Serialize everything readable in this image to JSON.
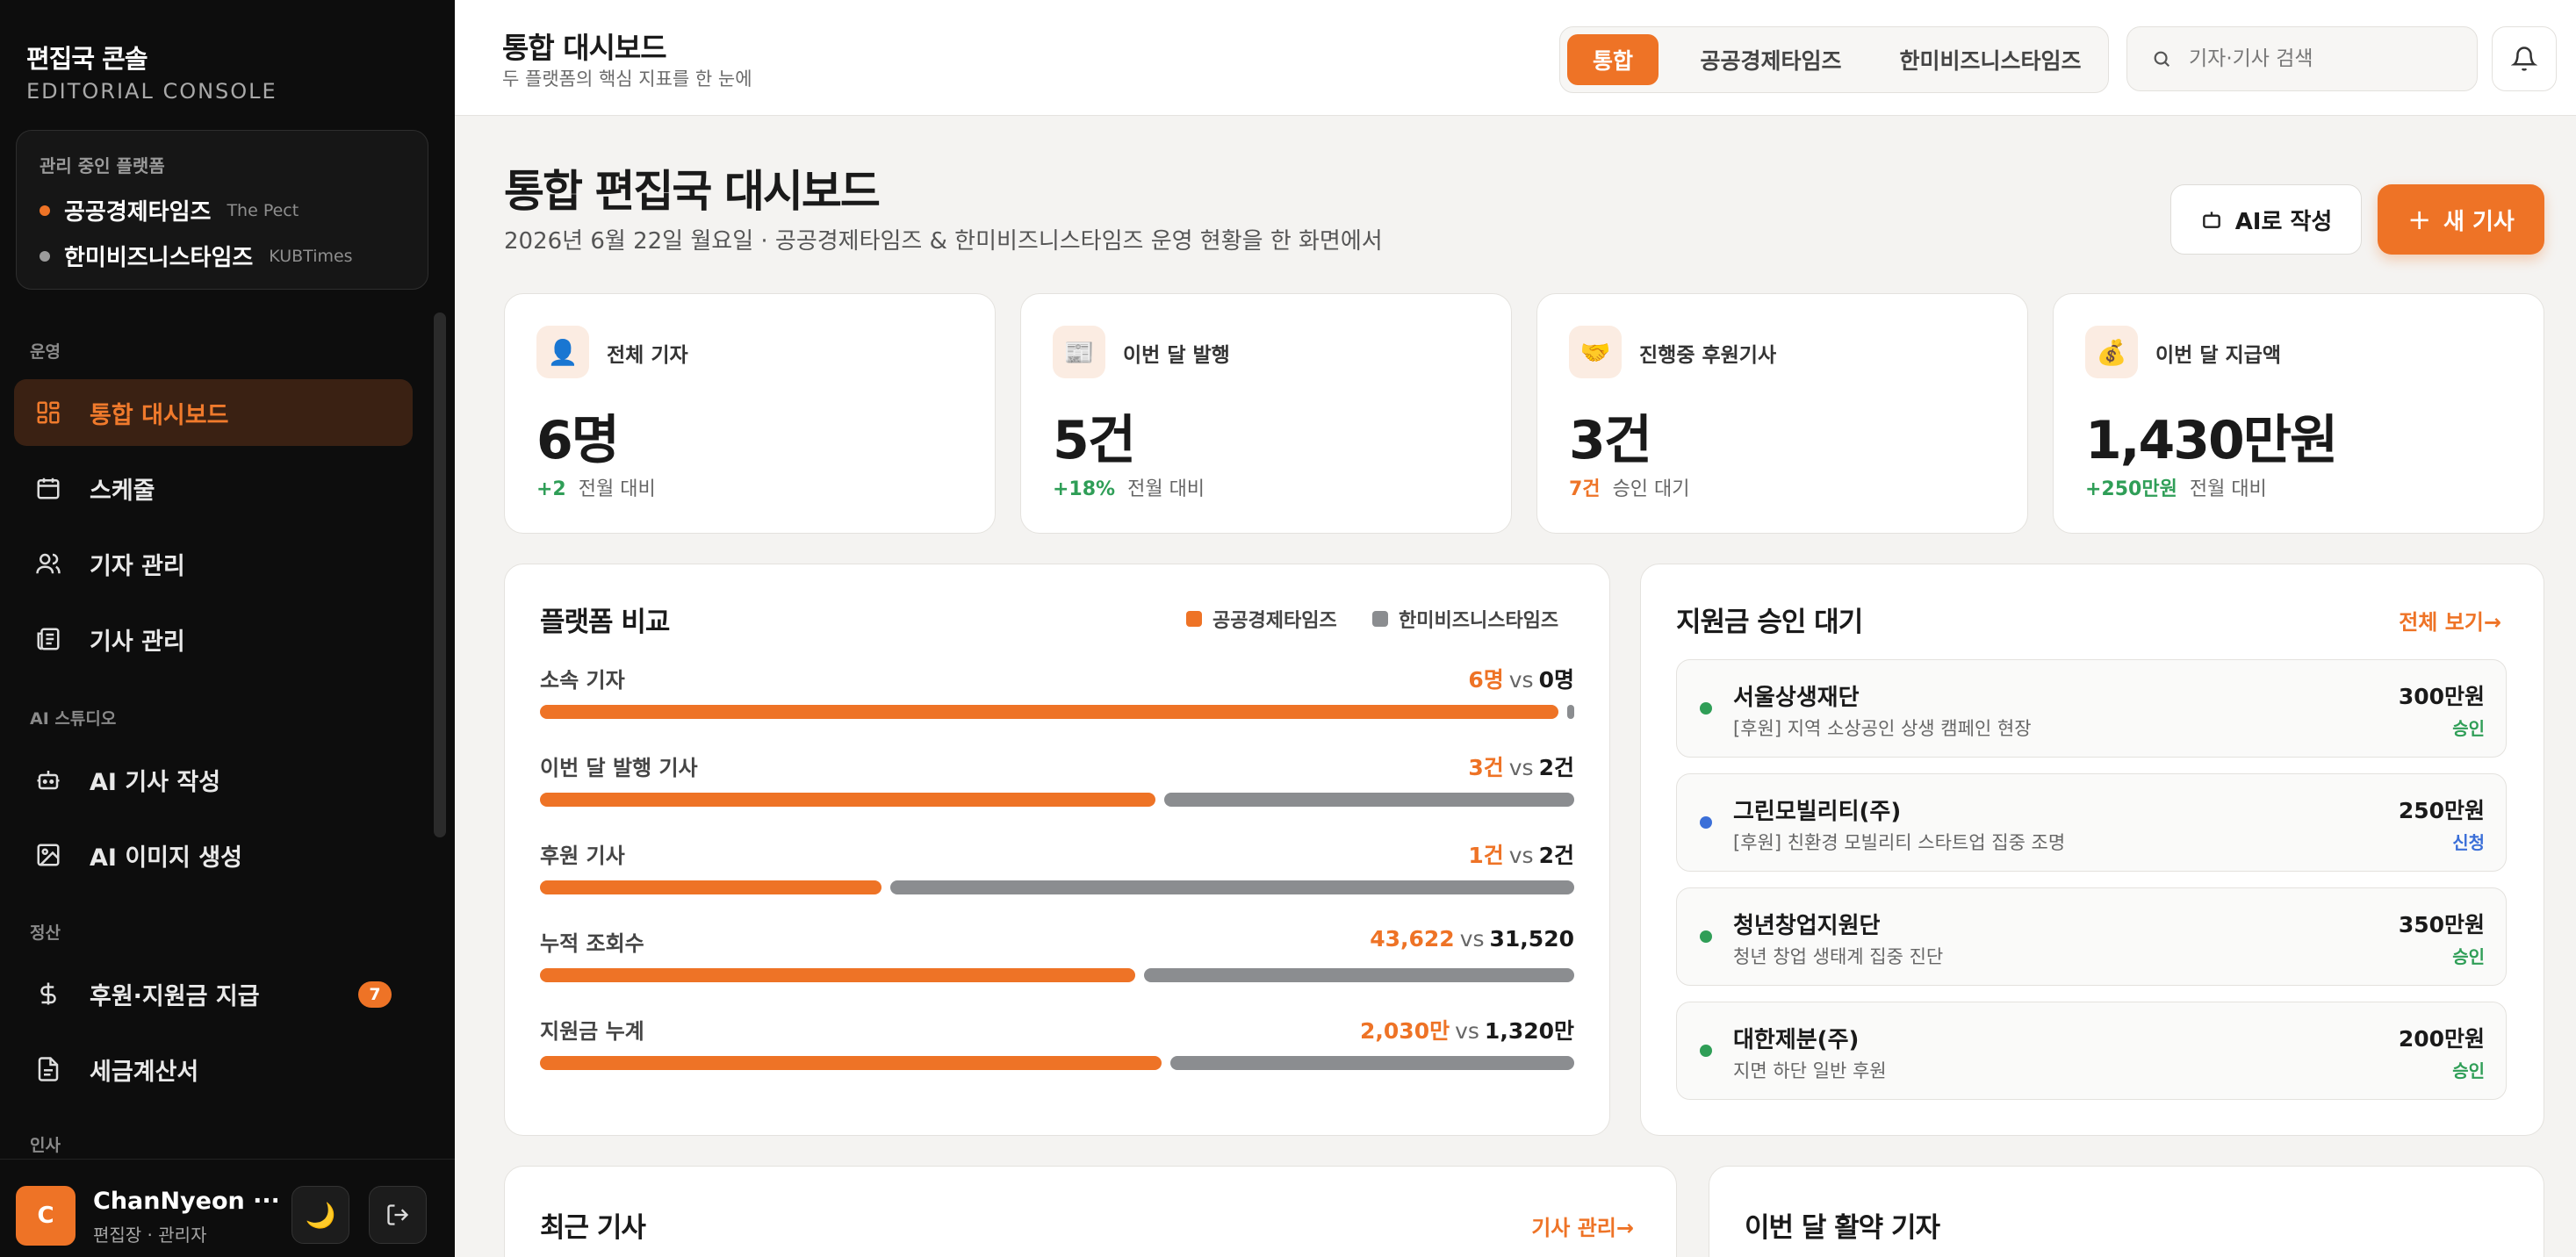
{
  "brand": {
    "name_ko": "편집국 콘솔",
    "name_en": "EDITORIAL CONSOLE"
  },
  "platforms": {
    "caption": "관리 중인 플랫폼",
    "items": [
      {
        "name": "공공경제타임즈",
        "sub": "The Pect",
        "color": "#ee7326"
      },
      {
        "name": "한미비즈니스타임즈",
        "sub": "KUBTimes",
        "color": "#9b9b9b"
      }
    ]
  },
  "sidebar": {
    "sections": {
      "ops": "운영",
      "ai": "AI 스튜디오",
      "settle": "정산",
      "hr": "인사"
    },
    "items": [
      {
        "label": "통합 대시보드",
        "icon": "dashboard-icon"
      },
      {
        "label": "스케줄",
        "icon": "calendar-icon"
      },
      {
        "label": "기자 관리",
        "icon": "users-icon"
      },
      {
        "label": "기사 관리",
        "icon": "newspaper-icon"
      },
      {
        "label": "AI 기사 작성",
        "icon": "robot-icon"
      },
      {
        "label": "AI 이미지 생성",
        "icon": "image-icon"
      },
      {
        "label": "후원·지원금 지급",
        "icon": "dollar-icon",
        "badge": "7"
      },
      {
        "label": "세금계산서",
        "icon": "document-icon"
      }
    ]
  },
  "user": {
    "initial": "C",
    "name": "ChanNyeon ···",
    "role": "편집장 · 관리자"
  },
  "topbar": {
    "title": "통합 대시보드",
    "subtitle": "두 플랫폼의 핵심 지표를 한 눈에",
    "tabs": [
      "통합",
      "공공경제타임즈",
      "한미비즈니스타임즈"
    ],
    "search_placeholder": "기자·기사 검색"
  },
  "header": {
    "title": "통합 편집국 대시보드",
    "subtitle": "2026년 6월 22일 월요일 · 공공경제타임즈 & 한미비즈니스타임즈 운영 현황을 한 화면에서",
    "ai_button": "AI로 작성",
    "new_button": "새 기사"
  },
  "stats": [
    {
      "icon": "👤",
      "label": "전체 기자",
      "value": "6명",
      "delta": "+2",
      "foot": "전월 대비"
    },
    {
      "icon": "📰",
      "label": "이번 달 발행",
      "value": "5건",
      "delta": "+18%",
      "foot": "전월 대비"
    },
    {
      "icon": "🤝",
      "label": "진행중 후원기사",
      "value": "3건",
      "delta": "7건",
      "foot": "승인 대기"
    },
    {
      "icon": "💰",
      "label": "이번 달 지급액",
      "value": "1,430만원",
      "delta": "+250만원",
      "foot": "전월 대비"
    }
  ],
  "compare": {
    "title": "플랫폼 비교",
    "legend_a": "공공경제타임즈",
    "legend_b": "한미비즈니스타임즈",
    "vs": "vs",
    "rows": [
      {
        "label": "소속 기자",
        "a": "6명",
        "b": "0명",
        "a_num": 6,
        "b_num": 0
      },
      {
        "label": "이번 달 발행 기사",
        "a": "3건",
        "b": "2건",
        "a_num": 3,
        "b_num": 2
      },
      {
        "label": "후원 기사",
        "a": "1건",
        "b": "2건",
        "a_num": 1,
        "b_num": 2
      },
      {
        "label": "누적 조회수",
        "a": "43,622",
        "b": "31,520",
        "a_num": 43622,
        "b_num": 31520
      },
      {
        "label": "지원금 누계",
        "a": "2,030만",
        "b": "1,320만",
        "a_num": 2030,
        "b_num": 1320
      }
    ]
  },
  "grants": {
    "title": "지원금 승인 대기",
    "link": "전체 보기→",
    "items": [
      {
        "name": "서울상생재단",
        "desc": "[후원] 지역 소상공인 상생 캠페인 현장",
        "amount": "300만원",
        "status": "승인",
        "color": "#2f9e57"
      },
      {
        "name": "그린모빌리티(주)",
        "desc": "[후원] 친환경 모빌리티 스타트업 집중 조명",
        "amount": "250만원",
        "status": "신청",
        "color": "#3b6fd8"
      },
      {
        "name": "청년창업지원단",
        "desc": "청년 창업 생태계 집중 진단",
        "amount": "350만원",
        "status": "승인",
        "color": "#2f9e57"
      },
      {
        "name": "대한제분(주)",
        "desc": "지면 하단 일반 후원",
        "amount": "200만원",
        "status": "승인",
        "color": "#2f9e57"
      }
    ]
  },
  "recent": {
    "title": "최근 기사",
    "link": "기사 관리→"
  },
  "active": {
    "title": "이번 달 활약 기자"
  }
}
